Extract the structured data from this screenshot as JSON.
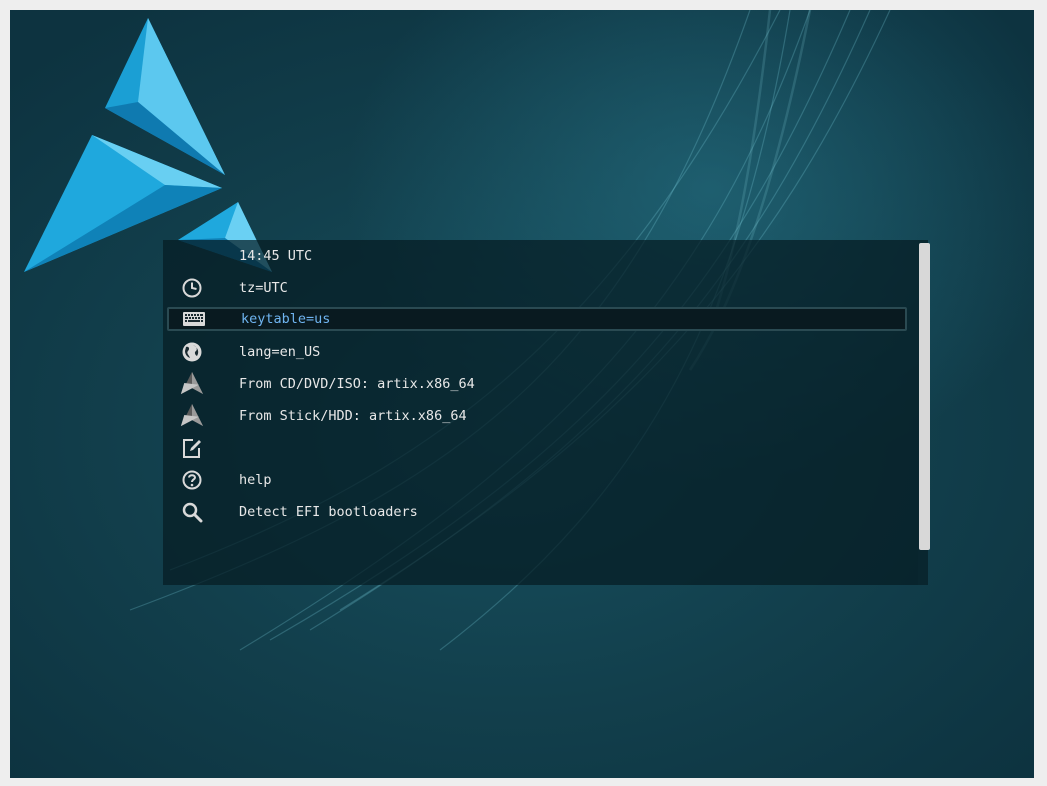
{
  "menu": {
    "items": [
      {
        "label": "14:45 UTC",
        "icon": "none",
        "selected": false
      },
      {
        "label": "tz=UTC",
        "icon": "clock-icon",
        "selected": false
      },
      {
        "label": "keytable=us",
        "icon": "keyboard-icon",
        "selected": true
      },
      {
        "label": "lang=en_US",
        "icon": "globe-icon",
        "selected": false
      },
      {
        "label": "From CD/DVD/ISO: artix.x86_64",
        "icon": "artix-logo-icon",
        "selected": false
      },
      {
        "label": "From Stick/HDD: artix.x86_64",
        "icon": "artix-logo-icon",
        "selected": false
      },
      {
        "label": "",
        "icon": "edit-icon",
        "selected": false
      },
      {
        "label": "help",
        "icon": "help-icon",
        "selected": false
      },
      {
        "label": "Detect EFI bootloaders",
        "icon": "search-icon",
        "selected": false
      }
    ]
  },
  "colors": {
    "selected_text": "#6fb4f0",
    "normal_text": "#e8e8e8",
    "logo_blue": "#1ea5d8",
    "background": "#134552"
  }
}
